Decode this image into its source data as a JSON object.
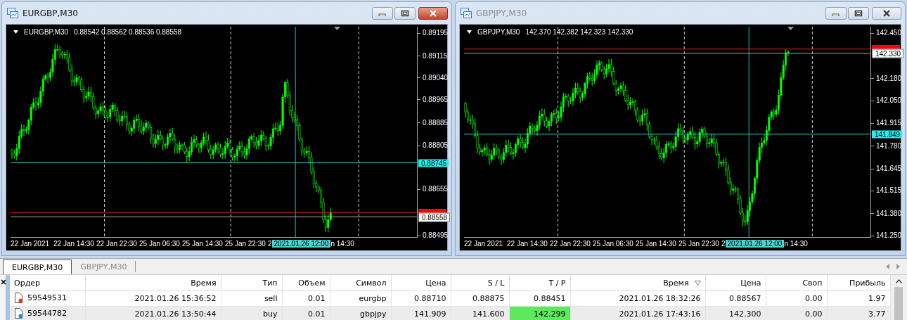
{
  "windows": [
    {
      "title": "EURGBP,M30",
      "active": true,
      "chart": {
        "symbol": "EURGBP,M30",
        "quote": "0.88542 0.88562 0.88536 0.88558",
        "price_ticks": [
          "0.89195",
          "0.89115",
          "0.89040",
          "0.88965",
          "0.88885",
          "0.88805",
          "0.88655",
          "0.88495"
        ],
        "line_label": "0.88745",
        "bid_label": "0.88558",
        "time_labels": [
          "22 Jan 2021",
          "22 Jan 14:30",
          "22 Jan 22:30",
          "25 Jan 06:30",
          "25 Jan 14:30",
          "25 Jan 22:30"
        ],
        "time_before": "2",
        "crosshair_time": "2021.01.26 12:00",
        "time_after": "n 14:30"
      }
    },
    {
      "title": "GBPJPY,M30",
      "active": false,
      "chart": {
        "symbol": "GBPJPY,M30",
        "quote": "142.370 142.382 142.323 142.330",
        "price_ticks": [
          "142.450",
          "142.180",
          "142.050",
          "141.915",
          "141.780",
          "141.645",
          "141.515",
          "141.380",
          "141.250"
        ],
        "line_label": "141.849",
        "bid_label": "142.330",
        "time_labels": [
          "22 Jan 2021",
          "22 Jan 14:30",
          "22 Jan 22:30",
          "25 Jan 06:30",
          "25 Jan 14:30",
          "25 Jan 22:30"
        ],
        "time_before": "2",
        "crosshair_time": "2021.01.26 12:00",
        "time_after": "n 14:30"
      }
    }
  ],
  "tabs": [
    {
      "label": "EURGBP,M30",
      "selected": true
    },
    {
      "label": "GBPJPY,M30",
      "selected": false
    }
  ],
  "table": {
    "columns": [
      {
        "label": "Ордер",
        "sorted": false
      },
      {
        "label": "Время",
        "sorted": false
      },
      {
        "label": "Тип",
        "sorted": false
      },
      {
        "label": "Объем",
        "sorted": false
      },
      {
        "label": "Символ",
        "sorted": false
      },
      {
        "label": "Цена",
        "sorted": false
      },
      {
        "label": "S / L",
        "sorted": false
      },
      {
        "label": "T / P",
        "sorted": false
      },
      {
        "label": "Время",
        "sorted": true
      },
      {
        "label": "Цена",
        "sorted": false
      },
      {
        "label": "Своп",
        "sorted": false
      },
      {
        "label": "Прибыль",
        "sorted": false
      }
    ],
    "rows": [
      {
        "kind": "sell",
        "tp_hit": false,
        "cells": [
          "59549531",
          "2021.01.26 15:36:52",
          "sell",
          "0.01",
          "eurgbp",
          "0.88710",
          "0.88875",
          "0.88451",
          "2021.01.26 18:32:26",
          "0.88567",
          "0.00",
          "1.97"
        ]
      },
      {
        "kind": "buy",
        "tp_hit": true,
        "cells": [
          "59544782",
          "2021.01.26 13:50:44",
          "buy",
          "0.01",
          "gbpjpy",
          "141.909",
          "141.600",
          "142.299",
          "2021.01.26 17:43:16",
          "142.300",
          "0.00",
          "3.77"
        ]
      }
    ]
  }
}
